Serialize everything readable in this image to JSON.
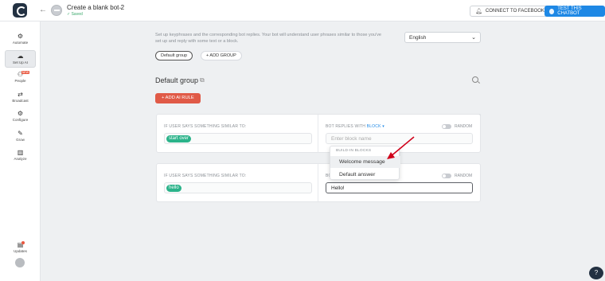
{
  "header": {
    "bot_title": "Create a blank bot 2",
    "status": "Saved",
    "connect_label": "CONNECT TO FACEBOOK",
    "test_label": "TEST THIS CHATBOT"
  },
  "sidebar": {
    "items": [
      {
        "label": "Automate",
        "icon": "automate-icon"
      },
      {
        "label": "Set Up AI",
        "icon": "ai-icon"
      },
      {
        "label": "People",
        "icon": "people-icon",
        "badge": "NEW"
      },
      {
        "label": "Broadcast",
        "icon": "broadcast-icon"
      },
      {
        "label": "Configure",
        "icon": "gear-icon"
      },
      {
        "label": "Grow",
        "icon": "grow-icon"
      },
      {
        "label": "Analyze",
        "icon": "chart-icon"
      },
      {
        "label": "Updates",
        "icon": "updates-icon"
      }
    ]
  },
  "main": {
    "description": "Set up keyphrases and the corresponding bot replies. Your bot will understand user phrases similar to those you've set up and reply with some text or a block.",
    "language": "English",
    "group_pill": "Default group",
    "add_group": "+ ADD GROUP",
    "group_title": "Default group",
    "add_rule": "+ ADD AI RULE"
  },
  "rules": [
    {
      "left_label": "IF USER SAYS SOMETHING SIMILAR TO:",
      "phrase": "start over",
      "right_label_prefix": "BOT REPLIES WITH",
      "right_label_link": "BLOCK",
      "random_label": "RANDOM",
      "input_placeholder": "Enter block name"
    },
    {
      "left_label": "IF USER SAYS SOMETHING SIMILAR TO:",
      "phrase": "hello",
      "right_label_prefix": "BO",
      "random_label": "RANDOM",
      "reply_value": "Hello!"
    }
  ],
  "dropdown": {
    "header": "BUILD-IN BLOCKS",
    "items": [
      "Welcome message",
      "Default answer"
    ]
  },
  "colors": {
    "accent_blue": "#1e88e5",
    "add_rule_red": "#e05a47",
    "tag_green": "#2bb38a",
    "annotation_red": "#d0021b"
  }
}
